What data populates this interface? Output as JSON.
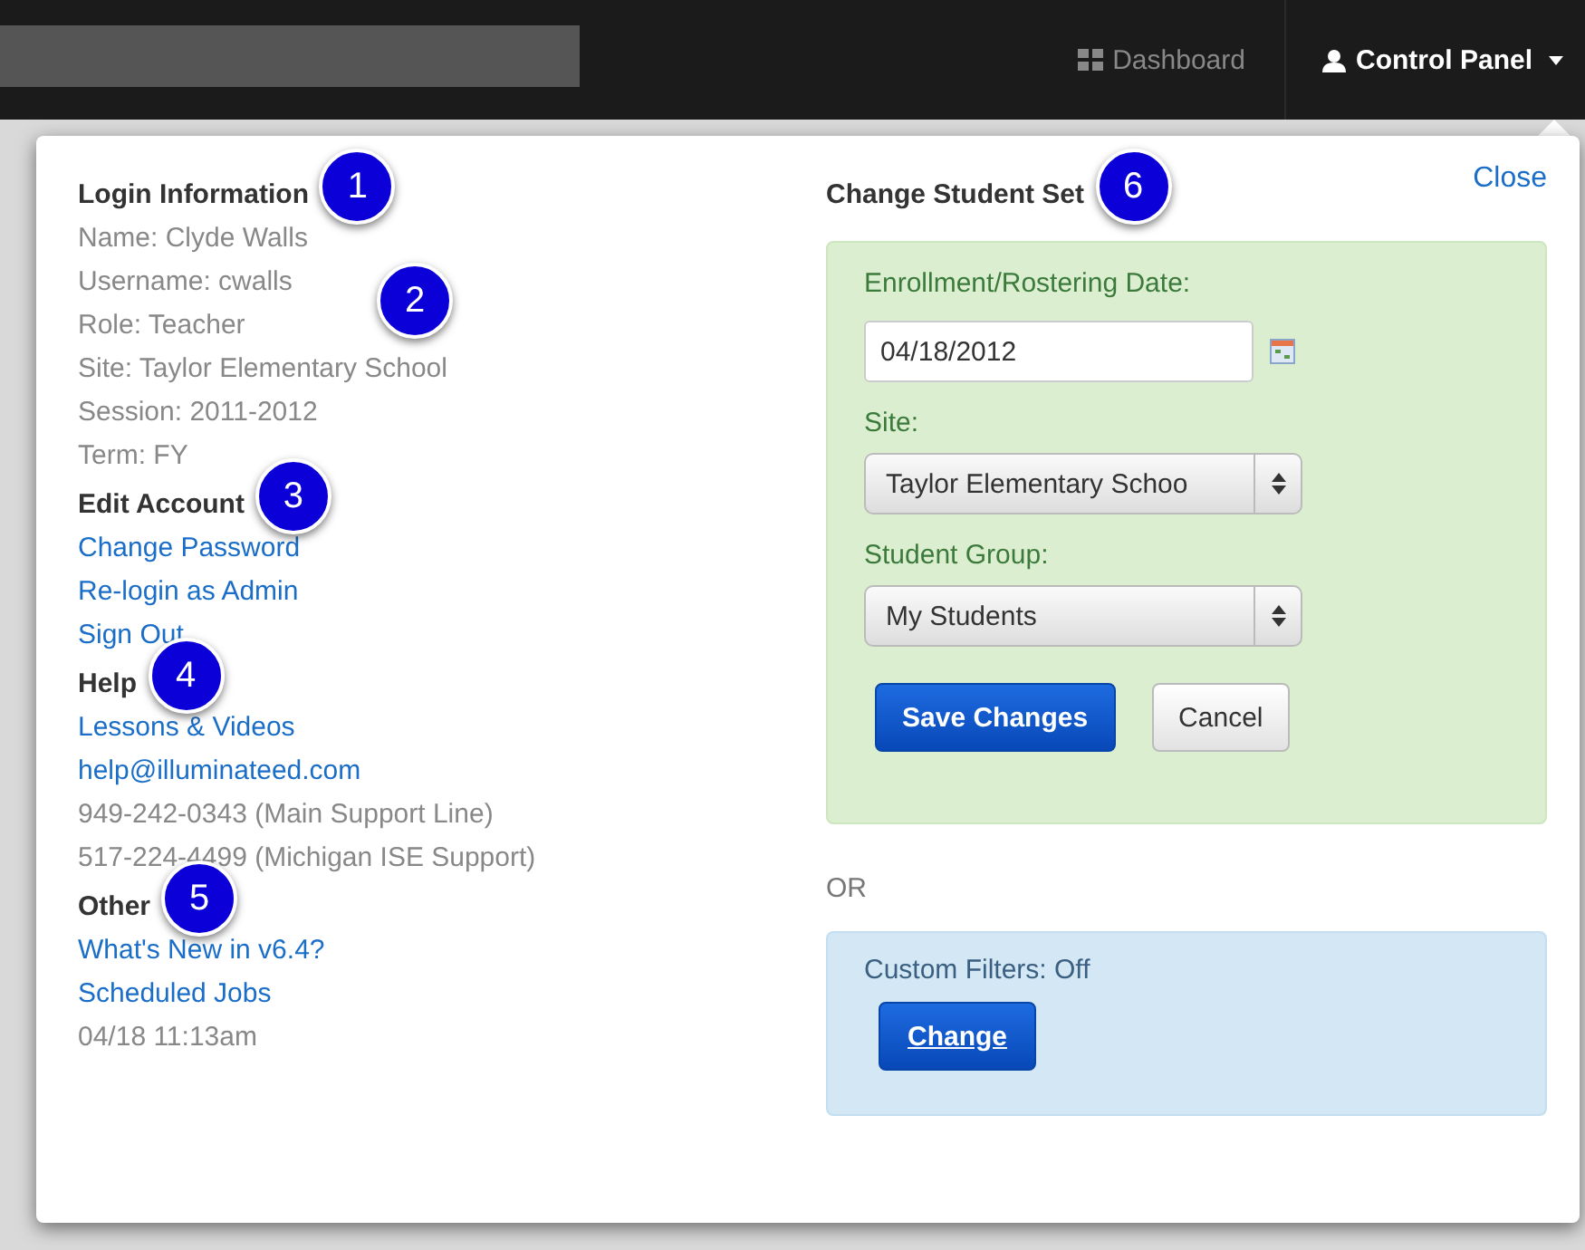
{
  "navbar": {
    "items": [
      {
        "label": "Dashboard",
        "kind": "dashboard",
        "selected": false
      },
      {
        "label": "Control Panel",
        "kind": "user",
        "selected": true
      }
    ]
  },
  "left_sections": [
    {
      "heading": "Login Information",
      "callout": "1",
      "items": [
        {
          "text": "Name: Clyde Walls",
          "kind": "text"
        },
        {
          "text": "Username: cwalls",
          "kind": "text",
          "callout": "2"
        },
        {
          "text": "Role: Teacher",
          "kind": "text"
        },
        {
          "text": "Site: Taylor Elementary School",
          "kind": "text"
        },
        {
          "text": "Session: 2011-2012",
          "kind": "text"
        },
        {
          "text": "Term: FY",
          "kind": "text"
        }
      ]
    },
    {
      "heading": "Edit Account",
      "callout": "3",
      "items": [
        {
          "text": "Change Password",
          "kind": "link"
        },
        {
          "text": "Re-login as Admin",
          "kind": "link"
        },
        {
          "text": "Sign Out",
          "kind": "link"
        }
      ]
    },
    {
      "heading": "Help",
      "callout": "4",
      "items": [
        {
          "text": "Lessons & Videos",
          "kind": "link"
        },
        {
          "text": "help@illuminateed.com",
          "kind": "link"
        },
        {
          "text": "949-242-0343 (Main Support Line)",
          "kind": "text"
        },
        {
          "text": "517-224-4499 (Michigan ISE Support)",
          "kind": "text"
        }
      ]
    },
    {
      "heading": "Other",
      "callout": "5",
      "items": [
        {
          "text": "What's New in v6.4?",
          "kind": "link"
        },
        {
          "text": "Scheduled Jobs",
          "kind": "link"
        },
        {
          "text": "04/18 11:13am",
          "kind": "text"
        }
      ]
    }
  ],
  "student_set": {
    "heading": "Change Student Set",
    "callout": "6",
    "close": "Close",
    "date_label": "Enrollment/Rostering Date:",
    "date_value": "04/18/2012",
    "site_label": "Site:",
    "site_value": "Taylor Elementary Schoo",
    "group_label": "Student Group:",
    "group_value": "My Students",
    "buttons": [
      {
        "label": "Save Changes",
        "kind": "primary"
      },
      {
        "label": "Cancel",
        "kind": "default"
      }
    ]
  },
  "or_text": "OR",
  "custom_filters": {
    "text": "Custom Filters: Off",
    "button": "Change"
  }
}
